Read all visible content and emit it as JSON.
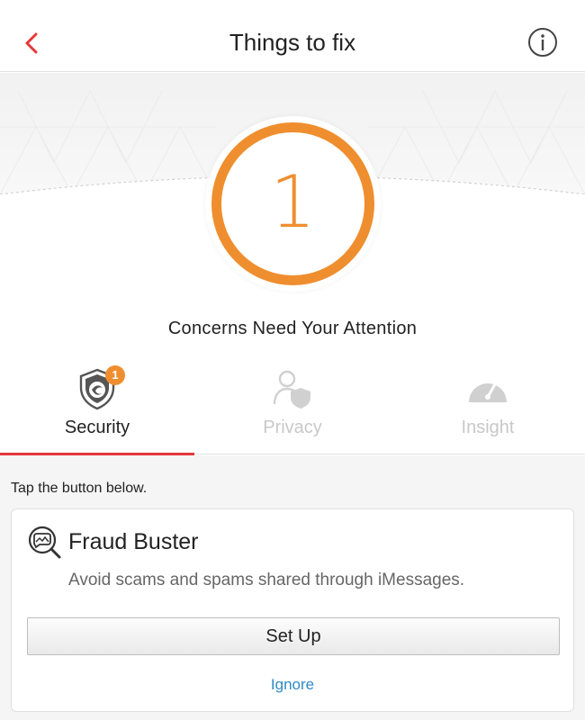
{
  "header": {
    "title": "Things to fix",
    "back_icon": "chevron-left-icon",
    "info_icon": "info-circle-icon"
  },
  "summary": {
    "count": "1",
    "message": "Concerns Need Your Attention",
    "ring_color": "#ef8e2f"
  },
  "tabs": [
    {
      "label": "Security",
      "icon": "shield-icon",
      "badge": "1",
      "active": true
    },
    {
      "label": "Privacy",
      "icon": "person-shield-icon",
      "active": false
    },
    {
      "label": "Insight",
      "icon": "gauge-icon",
      "active": false
    }
  ],
  "content": {
    "instruction": "Tap the button below.",
    "card": {
      "icon": "fraud-buster-icon",
      "title": "Fraud Buster",
      "description": "Avoid scams and spams shared through iMessages.",
      "setup_label": "Set Up",
      "ignore_label": "Ignore"
    }
  },
  "colors": {
    "accent_red": "#e5383b",
    "warning_orange": "#ef8e2f",
    "link_blue": "#2f8ac4"
  }
}
